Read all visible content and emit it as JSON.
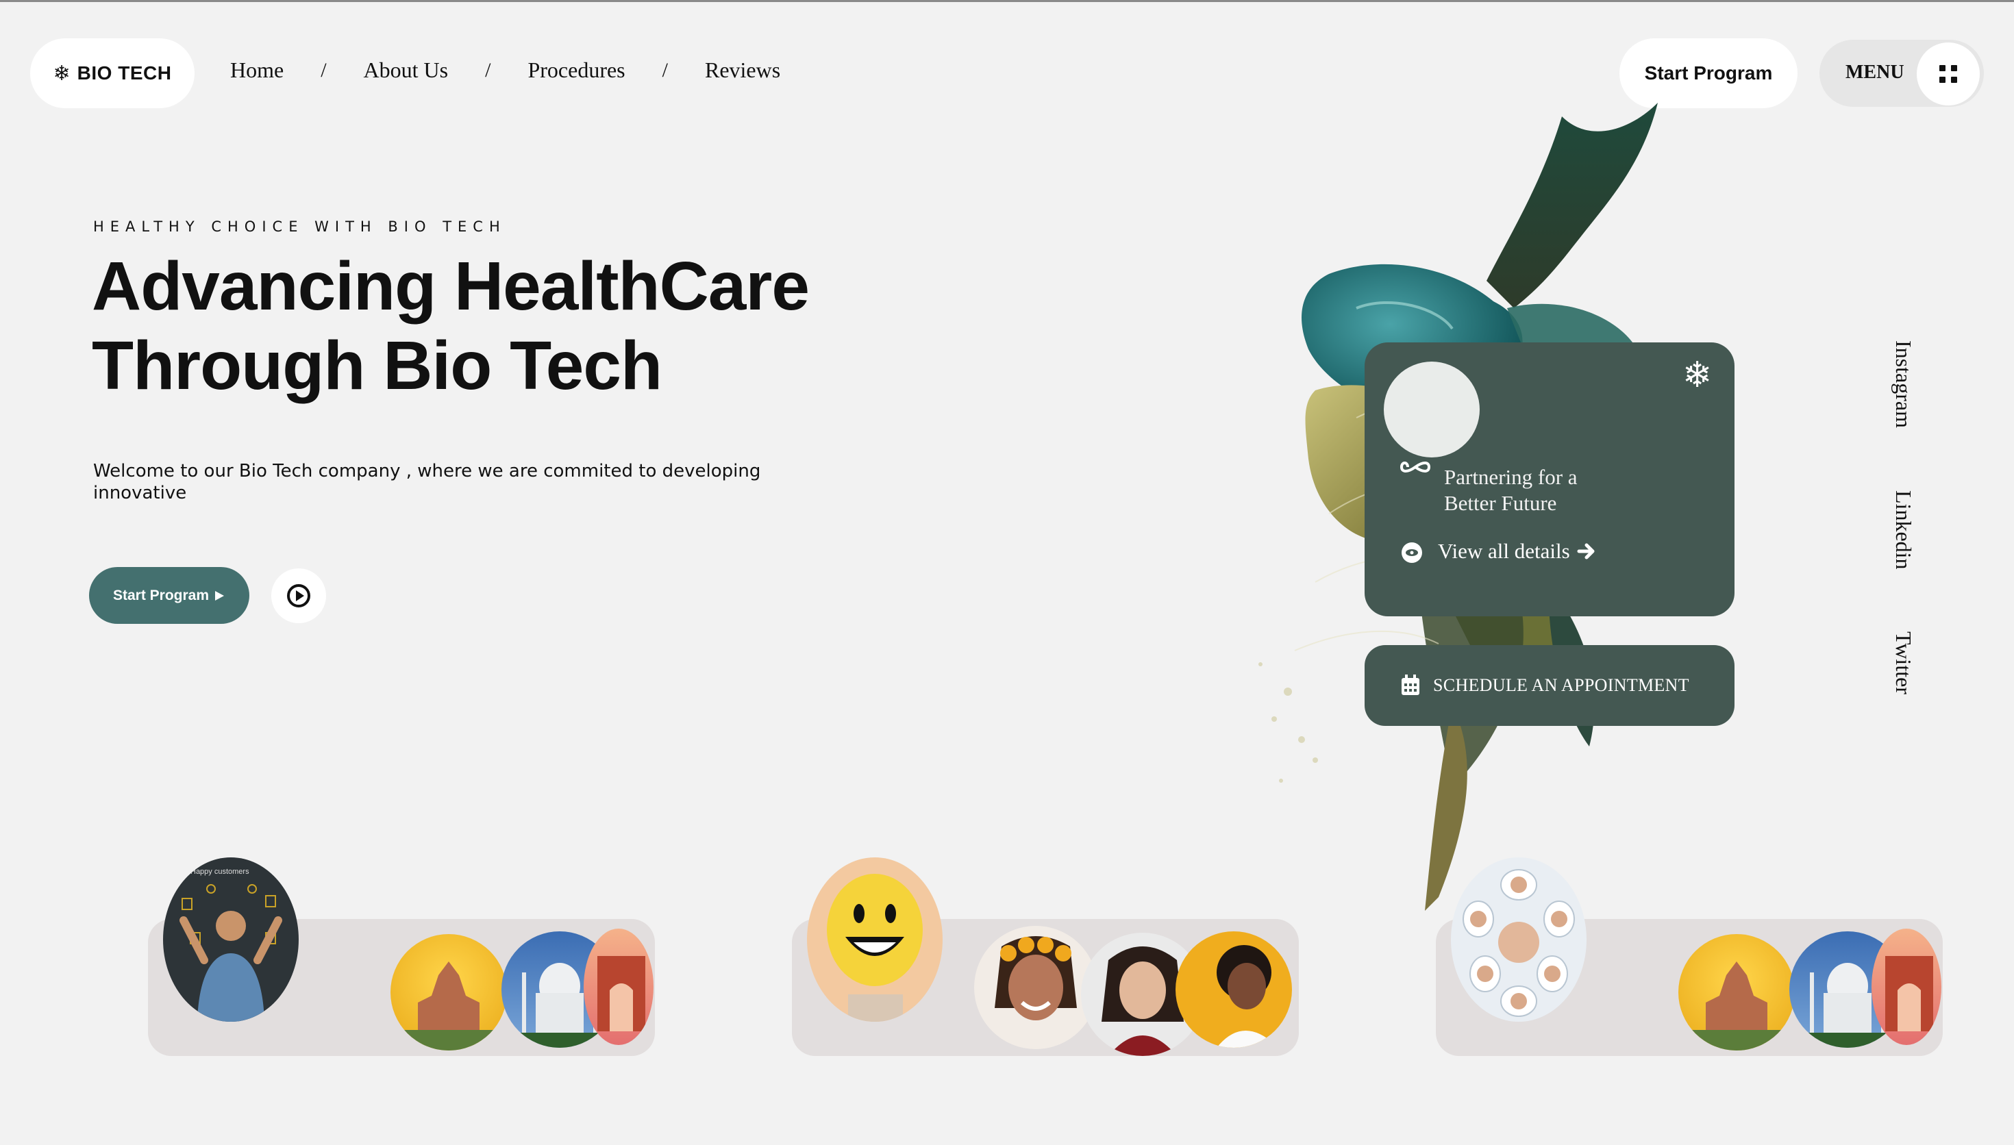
{
  "nav": {
    "brand": "BIO TECH",
    "brand_icon": "snowflake-icon",
    "links": [
      "Home",
      "About Us",
      "Procedures",
      "Reviews"
    ],
    "separator": "/",
    "start_program": "Start Program",
    "menu": "MENU"
  },
  "hero": {
    "eyebrow": "HEALTHY CHOICE WITH BIO TECH",
    "headline_line1": "Advancing HealthCare",
    "headline_line2": "Through Bio Tech",
    "welcome": "Welcome to our Bio Tech company , where we are commited to developing innovative",
    "start_button": "Start Program",
    "play_icon": "play-circle-icon"
  },
  "card": {
    "partner_text": "Partnering for a Better Future",
    "details_link": "View all details",
    "schedule": "SCHEDULE AN APPOINTMENT"
  },
  "social": [
    "Instagram",
    "Linkedin",
    "Twitter"
  ],
  "bottom": {
    "happy_customers_caption": "Happy customers"
  },
  "colors": {
    "accent": "#44706f",
    "card": "#445852",
    "background": "#f2f2f2",
    "bar": "#e2dede"
  }
}
